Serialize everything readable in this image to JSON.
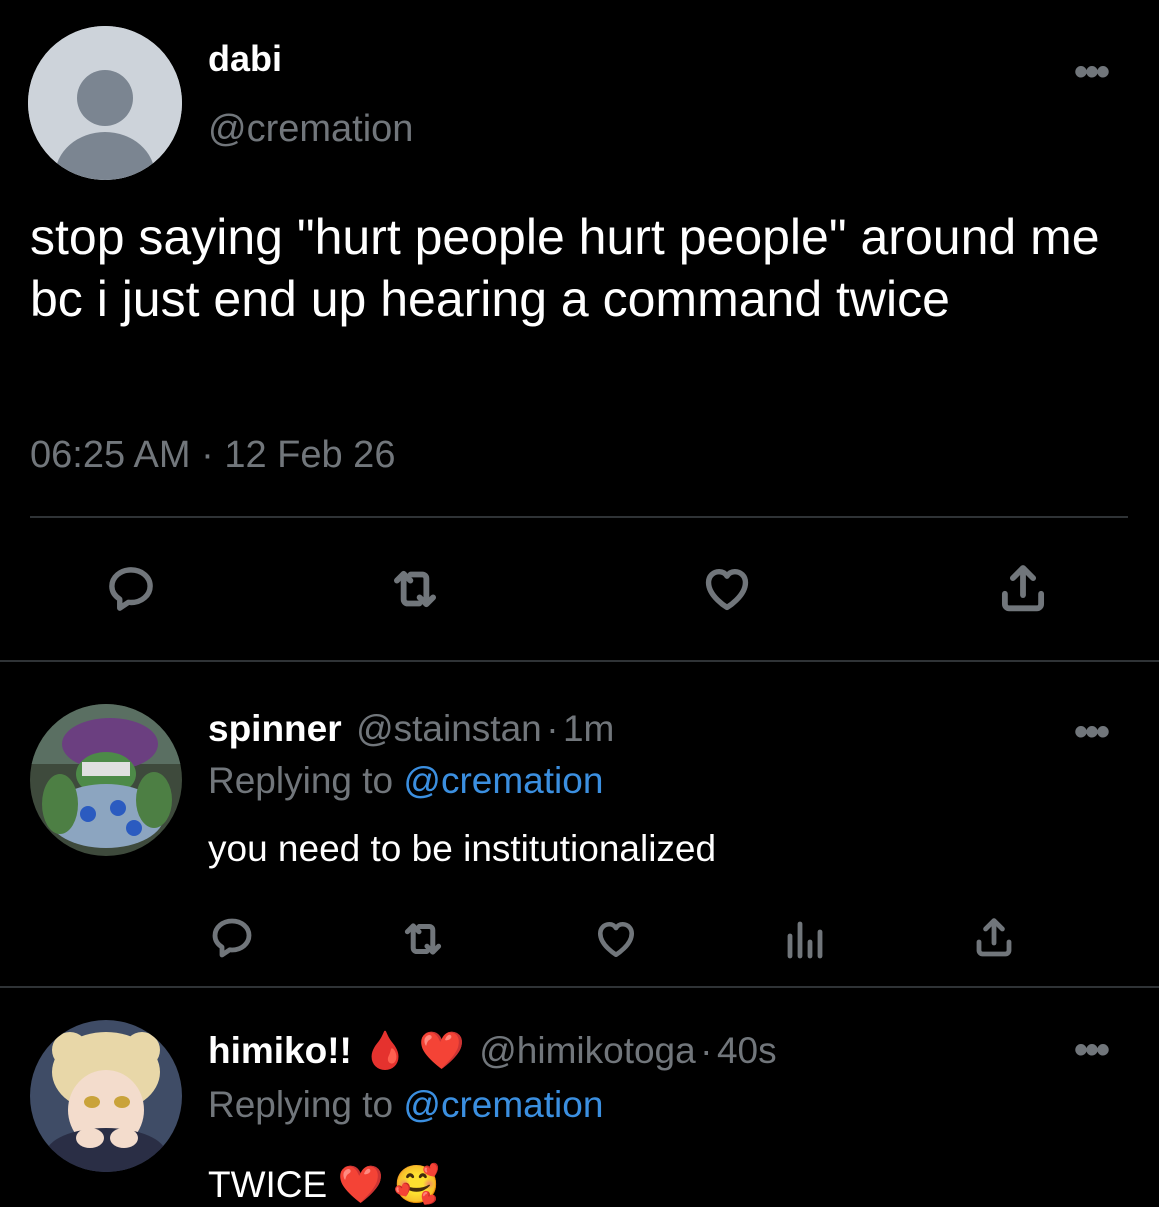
{
  "main_tweet": {
    "author_name": "dabi",
    "author_handle": "@cremation",
    "text": "stop saying \"hurt people hurt people\" around me bc i just end up hearing a command twice",
    "timestamp": "06:25 AM · 12 Feb 26",
    "avatar_icon": "default-profile-icon"
  },
  "replies": [
    {
      "author_name": "spinner",
      "author_handle": "@stainstan",
      "time_sep": "·",
      "time": "1m",
      "replying_prefix": "Replying to",
      "replying_handle": "@cremation",
      "text": "you need to be institutionalized"
    },
    {
      "author_name": "himiko!!",
      "emoji": "🩸 ❤️",
      "author_handle": "@himikotoga",
      "time_sep": "·",
      "time": "40s",
      "replying_prefix": "Replying to",
      "replying_handle": "@cremation",
      "text": "TWICE ❤️ 🥰"
    }
  ],
  "colors": {
    "background": "#000000",
    "text": "#ffffff",
    "muted": "#71767b",
    "link": "#3b8fe0",
    "divider": "#2f3336"
  }
}
